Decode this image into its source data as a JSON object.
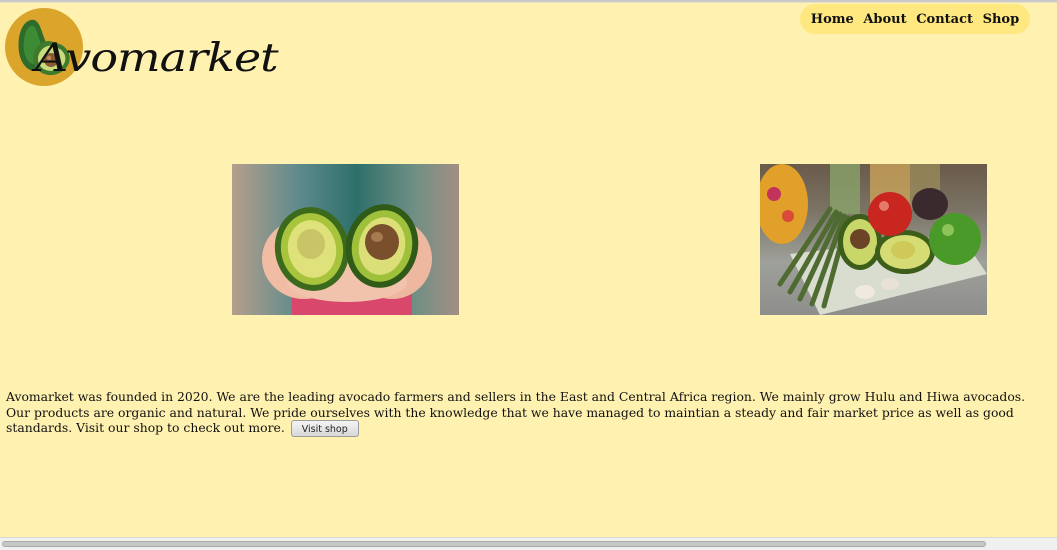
{
  "logo": {
    "text": "Avomarket"
  },
  "nav": {
    "items": [
      "Home",
      "About",
      "Contact",
      "Shop"
    ]
  },
  "images": [
    {
      "name": "avocado-halves-in-hands"
    },
    {
      "name": "vegetables-with-avocado"
    }
  ],
  "intro": {
    "text": "Avomarket was founded in 2020. We are the leading avocado farmers and sellers in the East and Central Africa region. We mainly grow Hulu and Hiwa avocados. Our products are organic and natural. We pride ourselves with the knowledge that we have managed to maintian a steady and fair market price as well as good standards. Visit our shop to check out more.",
    "button_label": "Visit shop"
  },
  "colors": {
    "background": "#fff1b0",
    "nav_pill": "#ffe880",
    "logo_circle": "#dba52c",
    "avocado_dark": "#2f6b2a",
    "avocado_light": "#b9d06a"
  }
}
